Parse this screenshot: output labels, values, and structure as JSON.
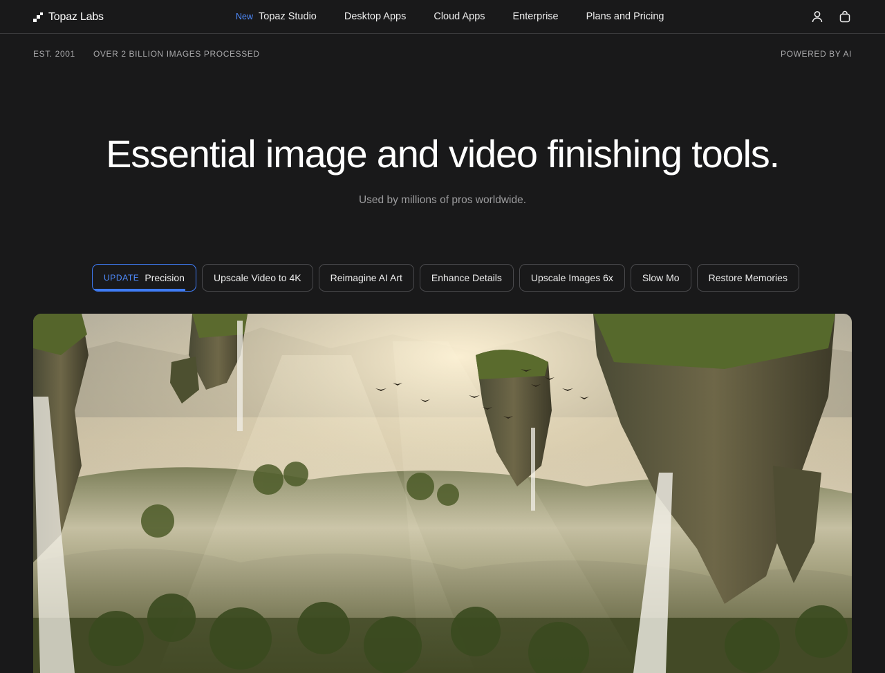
{
  "brand": {
    "name": "Topaz Labs"
  },
  "nav": {
    "items": [
      {
        "badge": "New",
        "label": "Topaz Studio"
      },
      {
        "label": "Desktop Apps"
      },
      {
        "label": "Cloud Apps"
      },
      {
        "label": "Enterprise"
      },
      {
        "label": "Plans and Pricing"
      }
    ]
  },
  "meta": {
    "established": "EST. 2001",
    "processed": "OVER 2 BILLION IMAGES PROCESSED",
    "powered": "POWERED BY AI"
  },
  "hero": {
    "title": "Essential image and video finishing tools.",
    "subtitle": "Used by millions of pros worldwide."
  },
  "features": {
    "active_progress": 0.9,
    "pills": [
      {
        "badge": "UPDATE",
        "label": "Precision",
        "active": true
      },
      {
        "label": "Upscale Video to 4K"
      },
      {
        "label": "Reimagine AI Art"
      },
      {
        "label": "Enhance Details"
      },
      {
        "label": "Upscale Images 6x"
      },
      {
        "label": "Slow Mo"
      },
      {
        "label": "Restore Memories"
      }
    ]
  },
  "colors": {
    "background": "#19191a",
    "accent": "#3f7cf6"
  },
  "icons": {
    "account": "user-icon",
    "cart": "shopping-bag-icon"
  }
}
